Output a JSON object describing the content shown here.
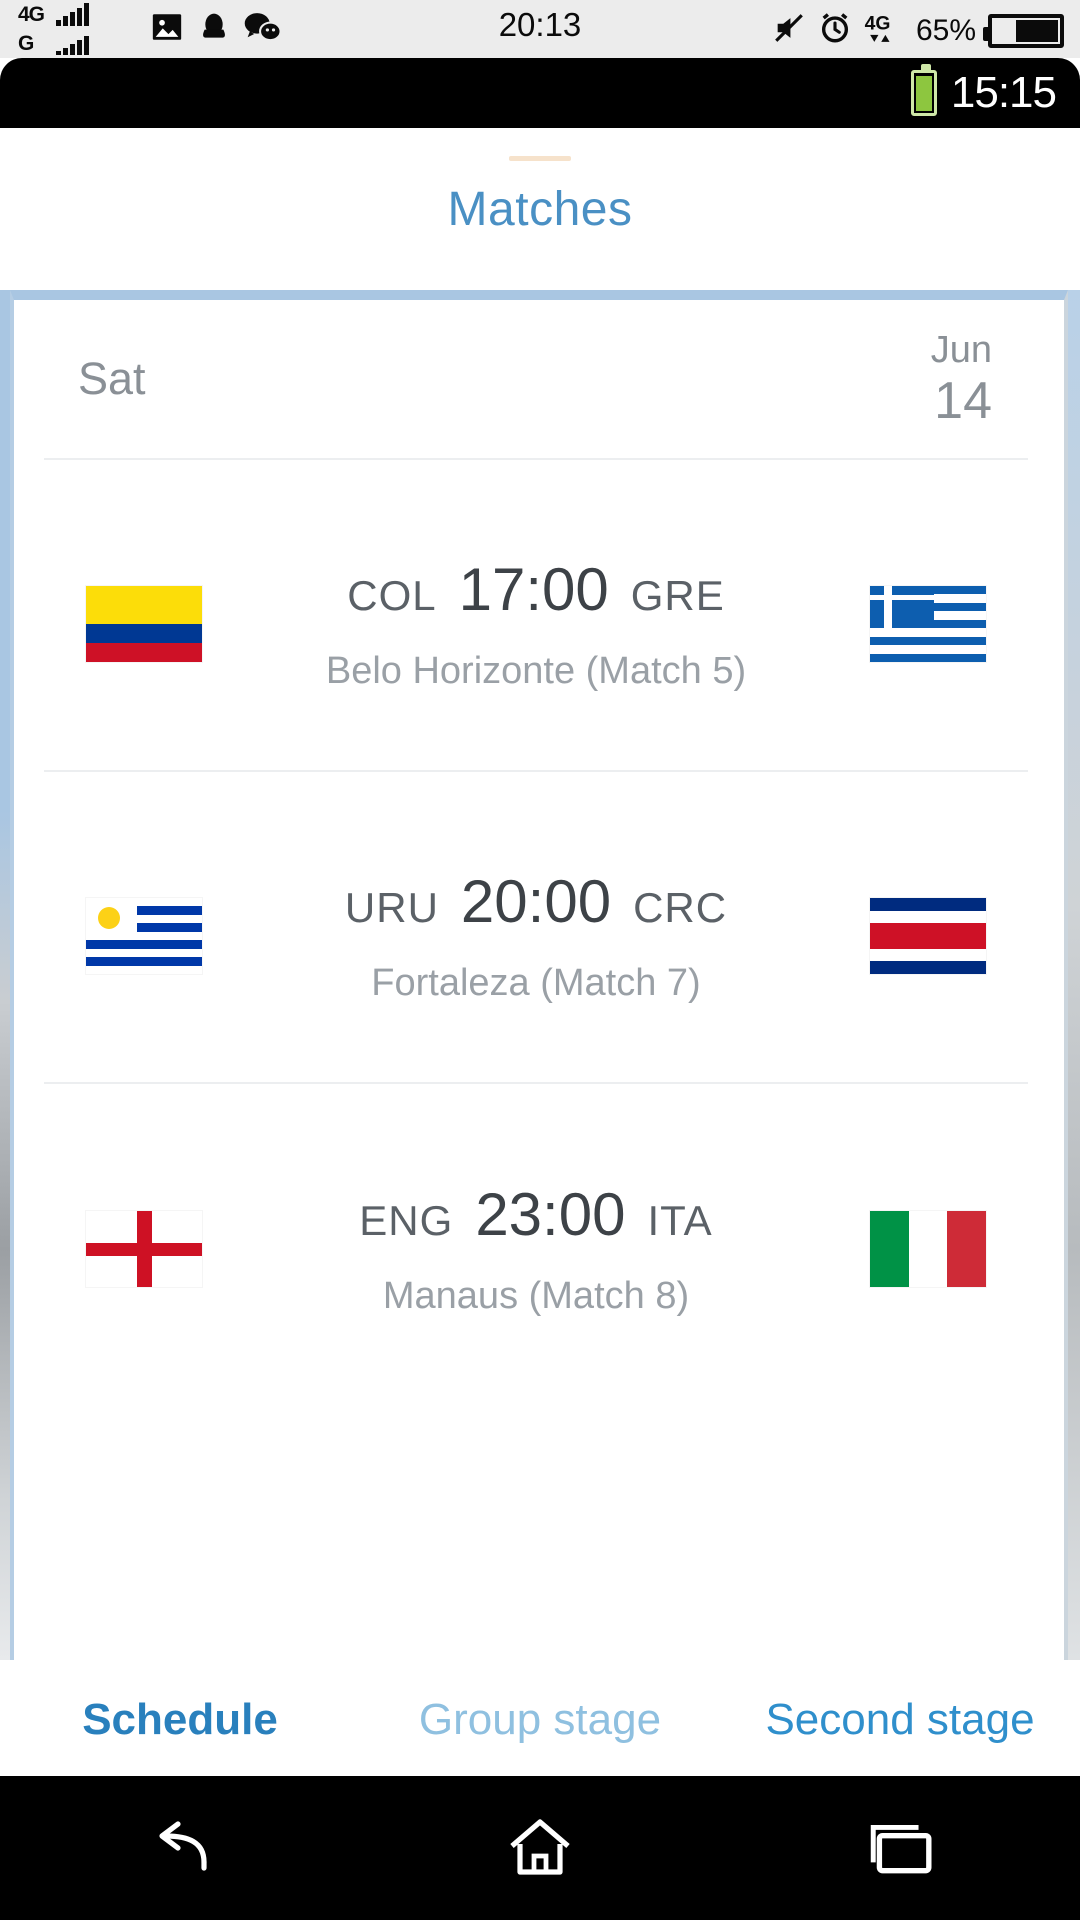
{
  "phone_status": {
    "network_primary": "4G",
    "network_secondary": "G",
    "clock": "20:13",
    "battery_percent": "65%",
    "icons": [
      "gallery-icon",
      "qq-icon",
      "wechat-icon",
      "mute-icon",
      "alarm-icon",
      "data-4g-icon",
      "battery-icon"
    ]
  },
  "inner_status": {
    "clock": "15:15",
    "battery_icon": "battery-full-green-icon"
  },
  "header": {
    "title": "Matches"
  },
  "date_header": {
    "day": "Sat",
    "month": "Jun",
    "day_number": "14"
  },
  "matches": [
    {
      "home_code": "COL",
      "away_code": "GRE",
      "time": "17:00",
      "venue": "Belo Horizonte (Match  5)",
      "home_flag": "flag-colombia-icon",
      "away_flag": "flag-greece-icon"
    },
    {
      "home_code": "URU",
      "away_code": "CRC",
      "time": "20:00",
      "venue": "Fortaleza (Match  7)",
      "home_flag": "flag-uruguay-icon",
      "away_flag": "flag-costa-rica-icon"
    },
    {
      "home_code": "ENG",
      "away_code": "ITA",
      "time": "23:00",
      "venue": "Manaus (Match  8)",
      "home_flag": "flag-england-icon",
      "away_flag": "flag-italy-icon"
    }
  ],
  "tabs": [
    {
      "label": "Schedule",
      "active": true
    },
    {
      "label": "Group stage",
      "active": false
    },
    {
      "label": "Second stage",
      "active": false
    }
  ],
  "navbar": {
    "back": "back-icon",
    "home": "home-icon",
    "recents": "recents-icon"
  },
  "colors": {
    "accent_blue": "#2980bd",
    "title_blue": "#4a90c4",
    "inactive_tab": "#8fc0e0",
    "panel_border": "#a9c6e2",
    "muted_text": "#9aa0a6",
    "battery_green": "#8dc63f"
  }
}
